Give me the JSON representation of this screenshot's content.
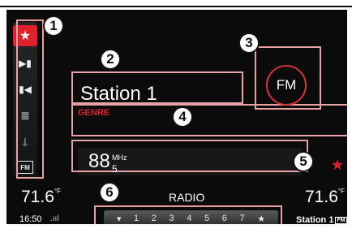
{
  "screen": {
    "title": "RADIO",
    "station": "Station 1",
    "genre": "GENRE",
    "band_indicator": "FM",
    "frequency_main": "88",
    "frequency_decimal": "5",
    "frequency_unit": "MHz",
    "temperature_left": "71.6",
    "temperature_right": "71.6",
    "temperature_unit": "°F",
    "clock": "16:50",
    "current_station_footer": "Station 1",
    "footer_band": "FM"
  },
  "left_rail": {
    "icons": [
      "favorite-star-icon",
      "seek-next-icon",
      "seek-prev-icon",
      "menu-list-icon",
      "scan-antenna-icon",
      "band-fm-icon"
    ]
  },
  "presets": {
    "items": [
      "1",
      "2",
      "3",
      "4",
      "5",
      "6",
      "7"
    ]
  },
  "callouts": [
    "1",
    "2",
    "3",
    "4",
    "5",
    "6"
  ],
  "colors": {
    "accent_red": "#e0212b",
    "highlight_pink": "#e9a1a5",
    "background": "#0b0b0b"
  }
}
